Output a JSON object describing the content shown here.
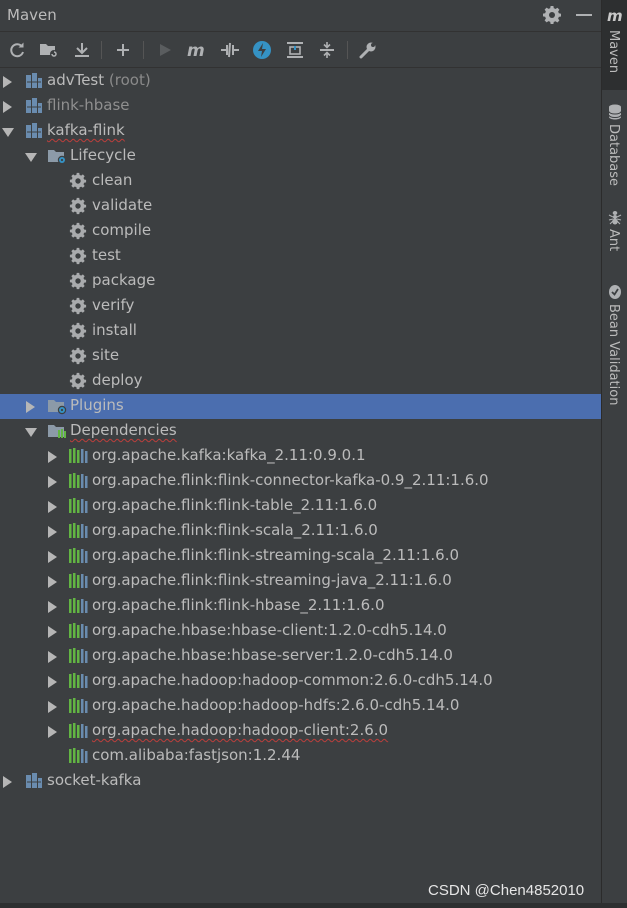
{
  "window": {
    "title": "Maven"
  },
  "toolbar": {
    "buttons": [
      {
        "name": "reload-icon"
      },
      {
        "name": "add-maven-project-icon"
      },
      {
        "name": "download-sources-icon"
      },
      {
        "name": "plus-icon"
      },
      {
        "name": "run-icon"
      },
      {
        "name": "execute-goal-icon"
      },
      {
        "name": "toggle-offline-icon"
      },
      {
        "name": "skip-tests-icon"
      },
      {
        "name": "show-dependencies-icon"
      },
      {
        "name": "collapse-all-icon"
      },
      {
        "name": "settings-wrench-icon"
      }
    ]
  },
  "tree": {
    "projects": [
      {
        "label": "advTest",
        "suffix": " (root)"
      },
      {
        "label": "flink-hbase"
      },
      {
        "label": "kafka-flink"
      },
      {
        "label": "socket-kafka"
      }
    ],
    "lifecycle": {
      "label": "Lifecycle",
      "goals": [
        "clean",
        "validate",
        "compile",
        "test",
        "package",
        "verify",
        "install",
        "site",
        "deploy"
      ]
    },
    "plugins": {
      "label": "Plugins"
    },
    "dependencies": {
      "label": "Dependencies",
      "items": [
        "org.apache.kafka:kafka_2.11:0.9.0.1",
        "org.apache.flink:flink-connector-kafka-0.9_2.11:1.6.0",
        "org.apache.flink:flink-table_2.11:1.6.0",
        "org.apache.flink:flink-scala_2.11:1.6.0",
        "org.apache.flink:flink-streaming-scala_2.11:1.6.0",
        "org.apache.flink:flink-streaming-java_2.11:1.6.0",
        "org.apache.flink:flink-hbase_2.11:1.6.0",
        "org.apache.hbase:hbase-client:1.2.0-cdh5.14.0",
        "org.apache.hbase:hbase-server:1.2.0-cdh5.14.0",
        "org.apache.hadoop:hadoop-common:2.6.0-cdh5.14.0",
        "org.apache.hadoop:hadoop-hdfs:2.6.0-cdh5.14.0",
        "org.apache.hadoop:hadoop-client:2.6.0",
        "com.alibaba:fastjson:1.2.44"
      ]
    }
  },
  "rightbar": {
    "tabs": [
      {
        "label": "Maven",
        "icon": "maven-icon"
      },
      {
        "label": "Database",
        "icon": "database-icon"
      },
      {
        "label": "Ant",
        "icon": "ant-icon"
      },
      {
        "label": "Bean Validation",
        "icon": "bean-validation-icon"
      }
    ]
  },
  "watermark": "CSDN @Chen4852010",
  "colors": {
    "background": "#3c3f41",
    "selection": "#4b6eaf",
    "text": "#bbbbbb",
    "error_underline": "#bc3f3c"
  }
}
